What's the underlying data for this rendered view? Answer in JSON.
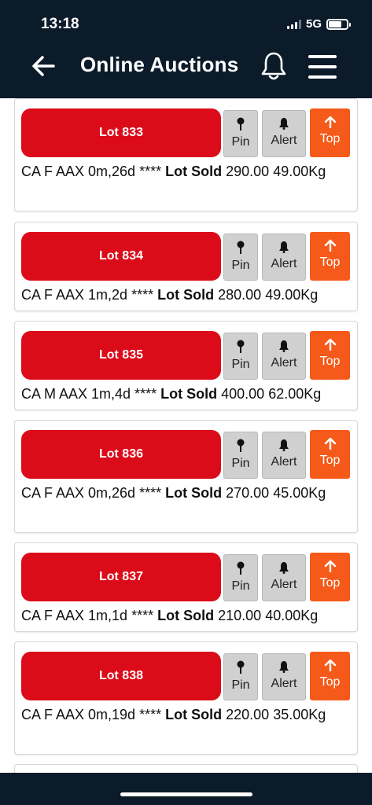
{
  "status_bar": {
    "time": "13:18",
    "network": "5G"
  },
  "header": {
    "title": "Online Auctions"
  },
  "buttons": {
    "pin": "Pin",
    "alert": "Alert",
    "top": "Top"
  },
  "lots": [
    {
      "lot": "Lot 833",
      "details": "CA F AAX 0m,26d ****",
      "status": "Lot Sold",
      "price": "290.00",
      "weight": "49.00Kg"
    },
    {
      "lot": "Lot 834",
      "details": "CA F AAX 1m,2d ****",
      "status": "Lot Sold",
      "price": "280.00",
      "weight": "49.00Kg"
    },
    {
      "lot": "Lot 835",
      "details": "CA M AAX 1m,4d ****",
      "status": "Lot Sold",
      "price": "400.00",
      "weight": "62.00Kg"
    },
    {
      "lot": "Lot 836",
      "details": "CA F AAX 0m,26d ****",
      "status": "Lot Sold",
      "price": "270.00",
      "weight": "45.00Kg"
    },
    {
      "lot": "Lot 837",
      "details": "CA F AAX 1m,1d ****",
      "status": "Lot Sold",
      "price": "210.00",
      "weight": "40.00Kg"
    },
    {
      "lot": "Lot 838",
      "details": "CA F AAX 0m,19d ****",
      "status": "Lot Sold",
      "price": "220.00",
      "weight": "35.00Kg"
    }
  ],
  "colors": {
    "header_bg": "#0c1b2a",
    "lot_button": "#dc0b19",
    "top_button": "#f55a1a",
    "tool_button": "#d0d0d0"
  },
  "icons": {
    "back": "arrow-left-icon",
    "bell": "bell-icon",
    "menu": "hamburger-menu-icon",
    "pin": "pin-icon",
    "alert": "bell-icon",
    "top": "arrow-up-icon"
  }
}
